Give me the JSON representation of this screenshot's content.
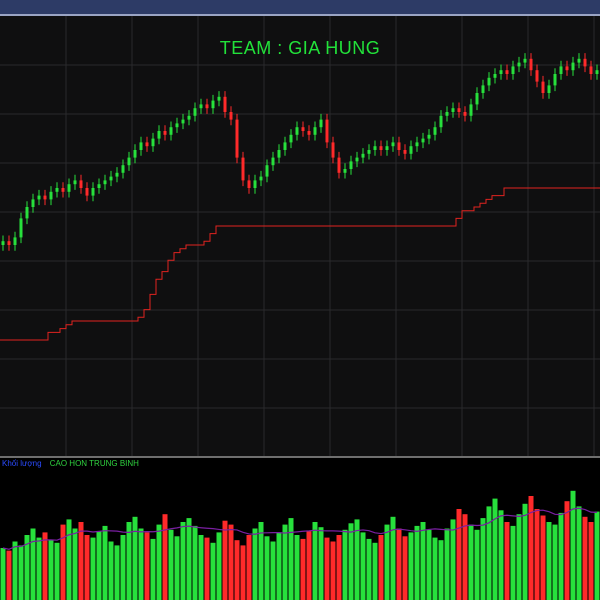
{
  "colors": {
    "background": "#0f0f10",
    "grid": "#2a2a2c",
    "up": "#27e03c",
    "down": "#ff2a2a",
    "stop_line": "#e0231f",
    "title": "#22e23a",
    "vol_avg": "#7a1fa2"
  },
  "chart_data": [
    {
      "type": "candlestick",
      "title": "TEAM : GIA HUNG",
      "grid": true,
      "ylim": [
        0,
        100
      ],
      "close": [
        46,
        45,
        47,
        52,
        55,
        57,
        58,
        57,
        59,
        60,
        59,
        61,
        62,
        60,
        58,
        60,
        61,
        62,
        63,
        64,
        66,
        68,
        70,
        72,
        71,
        73,
        75,
        74,
        76,
        77,
        78,
        79,
        81,
        82,
        81,
        83,
        84,
        80,
        78,
        68,
        62,
        60,
        62,
        63,
        66,
        68,
        70,
        72,
        74,
        76,
        75,
        74,
        76,
        78,
        72,
        68,
        64,
        65,
        67,
        68,
        69,
        70,
        71,
        70,
        71,
        72,
        70,
        69,
        71,
        72,
        73,
        74,
        76,
        79,
        80,
        81,
        80,
        79,
        82,
        85,
        87,
        89,
        90,
        91,
        90,
        92,
        93,
        94,
        91,
        88,
        85,
        87,
        90,
        92,
        91,
        93,
        94,
        92,
        90,
        91
      ],
      "stop": [
        20,
        20,
        20,
        20,
        20,
        20,
        20,
        20,
        22,
        22,
        23,
        24,
        25,
        25,
        25,
        25,
        25,
        25,
        25,
        25,
        25,
        25,
        25,
        26,
        28,
        32,
        36,
        38,
        41,
        43,
        44,
        45,
        45,
        45,
        46,
        48,
        50,
        50,
        50,
        50,
        50,
        50,
        50,
        50,
        50,
        50,
        50,
        50,
        50,
        50,
        50,
        50,
        50,
        50,
        50,
        50,
        50,
        50,
        50,
        50,
        50,
        50,
        50,
        50,
        50,
        50,
        50,
        50,
        50,
        50,
        50,
        50,
        50,
        50,
        50,
        50,
        52,
        54,
        54,
        55,
        56,
        57,
        58,
        58,
        60,
        60,
        60,
        60,
        60,
        60,
        60,
        60,
        60,
        60,
        60,
        60,
        60,
        60,
        60,
        60
      ]
    },
    {
      "type": "bar",
      "legend": [
        "Khối lượng",
        "CAO HON TRUNG BINH"
      ],
      "legend_placement": "top-left",
      "ylim": [
        0,
        100
      ],
      "values": [
        40,
        38,
        45,
        42,
        50,
        55,
        48,
        52,
        46,
        44,
        58,
        62,
        55,
        60,
        50,
        48,
        53,
        57,
        45,
        42,
        50,
        60,
        64,
        55,
        52,
        47,
        58,
        66,
        54,
        49,
        60,
        63,
        57,
        50,
        48,
        44,
        52,
        61,
        58,
        46,
        42,
        50,
        55,
        60,
        49,
        45,
        52,
        58,
        63,
        50,
        47,
        53,
        60,
        56,
        48,
        45,
        50,
        54,
        59,
        62,
        52,
        47,
        44,
        50,
        58,
        64,
        55,
        49,
        52,
        57,
        60,
        54,
        48,
        46,
        55,
        62,
        70,
        66,
        58,
        54,
        63,
        72,
        78,
        69,
        60,
        57,
        66,
        74,
        80,
        70,
        65,
        60,
        58,
        67,
        76,
        84,
        72,
        64,
        60,
        68
      ]
    }
  ]
}
